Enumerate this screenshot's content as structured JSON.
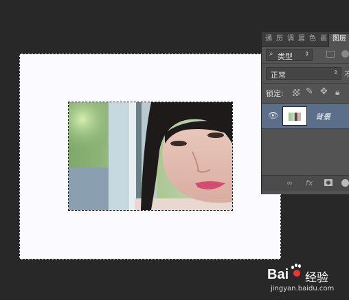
{
  "panel": {
    "tabs": [
      "通",
      "历",
      "调",
      "属",
      "色",
      "画",
      "图层"
    ],
    "filter": {
      "search_icon": "search-icon",
      "label": "类型"
    },
    "blend_mode": "正常",
    "blend_right_char": "不",
    "lock": {
      "label": "锁定:"
    },
    "layers": [
      {
        "name": "背景",
        "visible": true
      }
    ],
    "bottom_icons": [
      "link-icon",
      "fx-icon",
      "mask-icon",
      "adjustment-icon"
    ],
    "fx_label": "fx"
  },
  "watermark": {
    "brand": "Bai",
    "brand2": "经验",
    "url": "jingyan.baidu.com"
  },
  "colors": {
    "workspace": "#282828",
    "panel": "#535353",
    "selected_layer": "#5c6f8a",
    "doc": "#fbfbff"
  }
}
